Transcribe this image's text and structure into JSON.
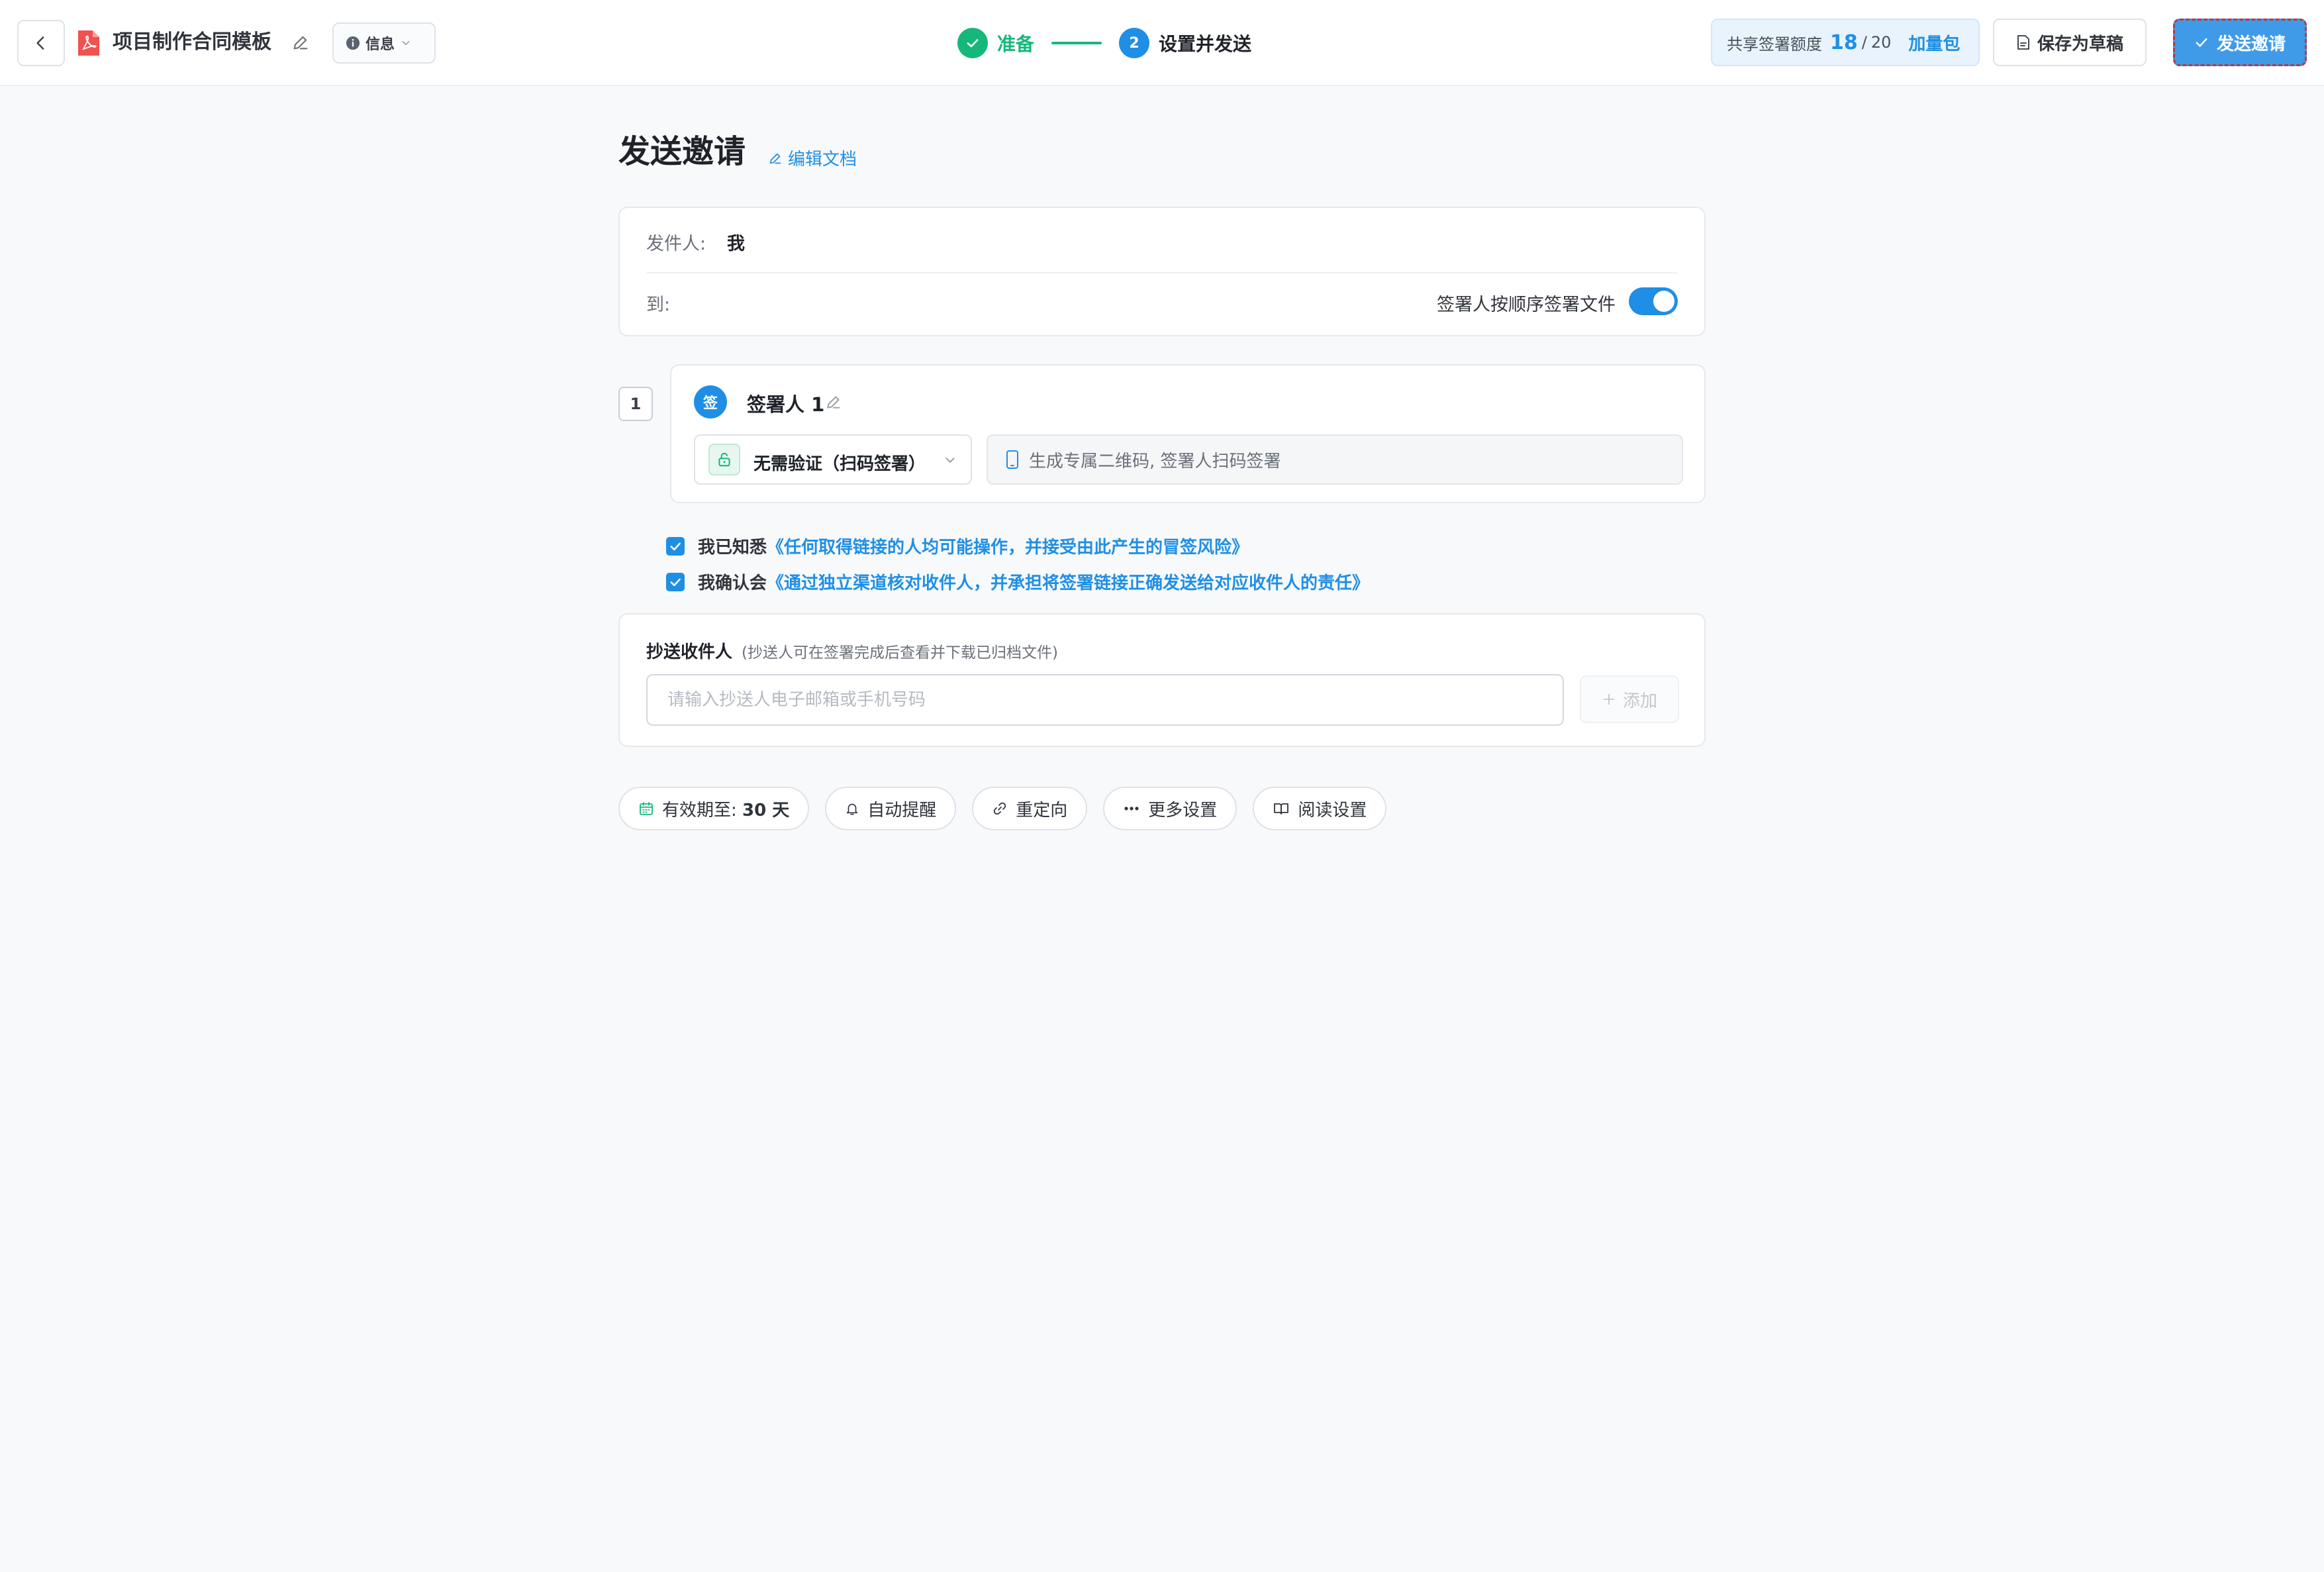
{
  "header": {
    "doc_title": "项目制作合同模板",
    "info_label": "信息",
    "steps": [
      {
        "label": "准备",
        "status": "done"
      },
      {
        "number": "2",
        "label": "设置并发送",
        "status": "current"
      }
    ],
    "quota": {
      "label": "共享签署额度",
      "used": "18",
      "separator": "/",
      "total": "20",
      "link": "加量包"
    },
    "save_draft_label": "保存为草稿",
    "send_label": "发送邀请"
  },
  "main": {
    "title": "发送邀请",
    "edit_doc_label": "编辑文档",
    "sender": {
      "label": "发件人:",
      "value": "我"
    },
    "to": {
      "label": "到:",
      "order_label": "签署人按顺序签署文件",
      "order_enabled": true
    },
    "signers": [
      {
        "order": "1",
        "avatar_text": "签",
        "name": "签署人 1",
        "verification": "无需验证（扫码签署）",
        "description": "生成专属二维码, 签署人扫码签署"
      }
    ],
    "agreements": [
      {
        "prefix": "我已知悉",
        "link": "《任何取得链接的人均可能操作，并接受由此产生的冒签风险》",
        "checked": true
      },
      {
        "prefix": "我确认会",
        "link": "《通过独立渠道核对收件人，并承担将签署链接正确发送给对应收件人的责任》",
        "checked": true
      }
    ],
    "cc": {
      "title": "抄送收件人",
      "hint": "(抄送人可在签署完成后查看并下载已归档文件)",
      "placeholder": "请输入抄送人电子邮箱或手机号码",
      "add_label": "添加"
    },
    "options": {
      "validity_label": "有效期至:",
      "validity_value": "30 天",
      "reminder": "自动提醒",
      "redirect": "重定向",
      "more": "更多设置",
      "reading": "阅读设置"
    }
  },
  "colors": {
    "accent": "#1f8fe5",
    "success": "#16b87a",
    "pdf_red": "#f0524f"
  }
}
